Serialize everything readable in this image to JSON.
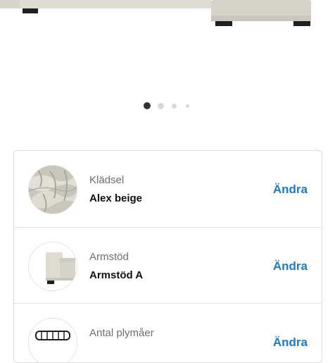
{
  "carousel": {
    "total": 4,
    "active": 0
  },
  "options": [
    {
      "label": "Klädsel",
      "value": "Alex beige",
      "action": "Ändra",
      "icon": "fabric-swatch-icon"
    },
    {
      "label": "Armstöd",
      "value": "Armstöd A",
      "action": "Ändra",
      "icon": "armrest-icon"
    },
    {
      "label": "Antal plymåer",
      "value": "",
      "action": "Ändra",
      "icon": "cushions-icon"
    }
  ],
  "colors": {
    "accent": "#1c7cbf",
    "sofa": "#d8d6cc",
    "dot_active": "#333333",
    "dot_inactive": "#d9d9d9"
  }
}
